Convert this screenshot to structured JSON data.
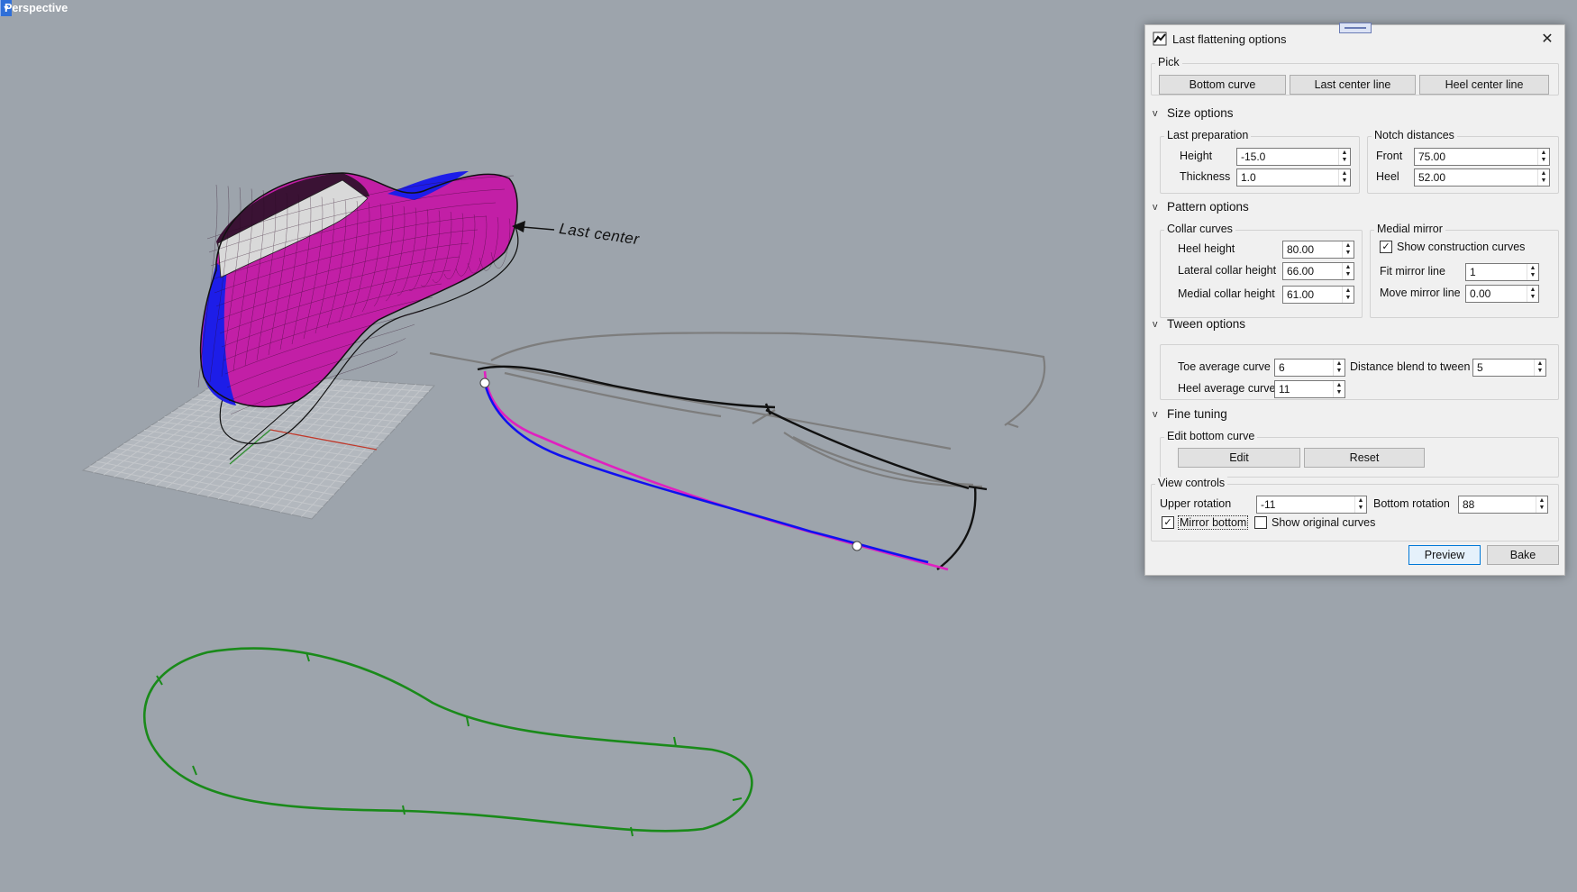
{
  "viewport": {
    "name": "Perspective",
    "annotation": "Last center"
  },
  "dialog": {
    "title": "Last flattening options",
    "pick": {
      "label": "Pick",
      "bottom_curve": "Bottom curve",
      "last_center_line": "Last center line",
      "heel_center_line": "Heel center line"
    },
    "size_options": {
      "label": "Size options",
      "last_preparation": {
        "label": "Last preparation",
        "height_label": "Height",
        "height_value": "-15.0",
        "thickness_label": "Thickness",
        "thickness_value": "1.0"
      },
      "notch_distances": {
        "label": "Notch distances",
        "front_label": "Front",
        "front_value": "75.00",
        "heel_label": "Heel",
        "heel_value": "52.00"
      }
    },
    "pattern_options": {
      "label": "Pattern options",
      "collar_curves": {
        "label": "Collar curves",
        "heel_height_label": "Heel height",
        "heel_height_value": "80.00",
        "lateral_label": "Lateral collar height",
        "lateral_value": "66.00",
        "medial_label": "Medial collar height",
        "medial_value": "61.00"
      },
      "medial_mirror": {
        "label": "Medial mirror",
        "show_construction_label": "Show construction curves",
        "show_construction_checked": true,
        "fit_label": "Fit mirror line",
        "fit_value": "1",
        "move_label": "Move mirror line",
        "move_value": "0.00"
      }
    },
    "tween_options": {
      "label": "Tween options",
      "toe_label": "Toe average curve",
      "toe_value": "6",
      "blend_label": "Distance blend to tween",
      "blend_value": "5",
      "heel_label": "Heel average curve",
      "heel_value": "11"
    },
    "fine_tuning": {
      "label": "Fine tuning",
      "edit_bottom_label": "Edit bottom curve",
      "edit": "Edit",
      "reset": "Reset"
    },
    "view_controls": {
      "label": "View controls",
      "upper_label": "Upper rotation",
      "upper_value": "-11",
      "bottom_label": "Bottom rotation",
      "bottom_value": "88",
      "mirror_bottom": "Mirror bottom",
      "mirror_bottom_checked": true,
      "show_original": "Show original curves",
      "show_original_checked": false
    },
    "preview": "Preview",
    "bake": "Bake"
  },
  "colors": {
    "background": "#9da4ac",
    "tab": "#2f6fd8",
    "magenta": "#e020c0",
    "blue": "#1010f0",
    "green": "#1a8a1a",
    "gray_curve": "#7a7a7a"
  }
}
